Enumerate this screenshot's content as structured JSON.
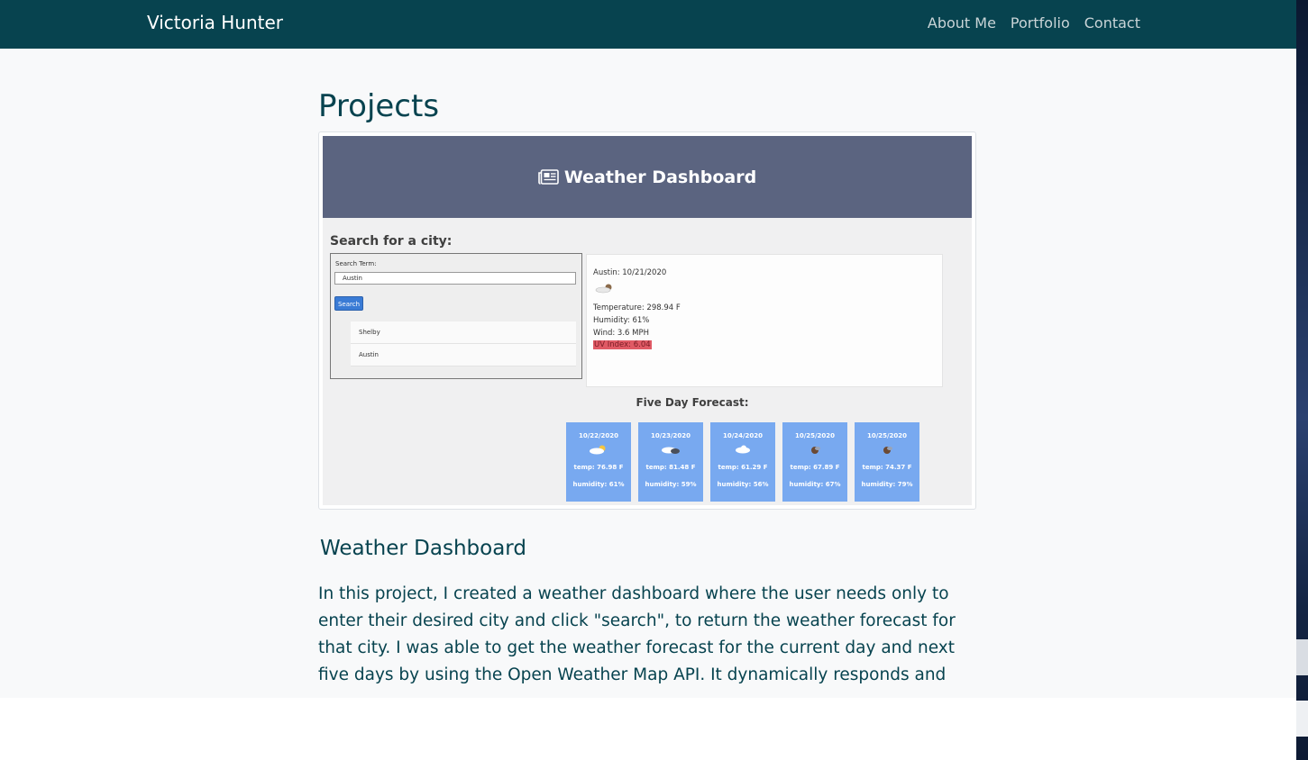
{
  "navbar": {
    "brand": "Victoria Hunter",
    "links": [
      "About Me",
      "Portfolio",
      "Contact"
    ]
  },
  "page_title": "Projects",
  "thumbnail": {
    "header": "Weather Dashboard",
    "search_title": "Search for a city:",
    "search_term_label": "Search Term:",
    "search_value": "Austin",
    "search_button": "Search",
    "history": [
      "Shelby",
      "Austin"
    ],
    "current": {
      "city_date": "Austin: 10/21/2020",
      "temperature": "Temperature: 298.94 F",
      "humidity": "Humidity: 61%",
      "wind": "Wind: 3.6 MPH",
      "uv": "UV Index: 6.04"
    },
    "forecast_title": "Five Day Forecast:",
    "forecast": [
      {
        "date": "10/22/2020",
        "temp": "temp: 76.98 F",
        "humidity": "humidity: 61%",
        "icon": "sun-cloud-icon"
      },
      {
        "date": "10/23/2020",
        "temp": "temp: 81.48 F",
        "humidity": "humidity: 59%",
        "icon": "dark-cloud-icon"
      },
      {
        "date": "10/24/2020",
        "temp": "temp: 61.29 F",
        "humidity": "humidity: 56%",
        "icon": "cloud-icon"
      },
      {
        "date": "10/25/2020",
        "temp": "temp: 67.89 F",
        "humidity": "humidity: 67%",
        "icon": "rain-icon"
      },
      {
        "date": "10/25/2020",
        "temp": "temp: 74.37 F",
        "humidity": "humidity: 79%",
        "icon": "rain-icon"
      }
    ],
    "colors": {
      "header_bg": "#5b6480",
      "card_bg": "#78a9f0",
      "uv_bg": "#e05a65"
    }
  },
  "project_title": "Weather Dashboard",
  "project_description": "In this project, I created a weather dashboard where the user needs only to enter their desired city and click \"search\", to return the weather forecast for that city. I was able to get the weather forecast for the current day and next five days by using the Open Weather Map API. It dynamically responds and",
  "colors": {
    "navbar": "#07434f",
    "text": "#07434f",
    "page_bg": "#f8f9fa"
  }
}
